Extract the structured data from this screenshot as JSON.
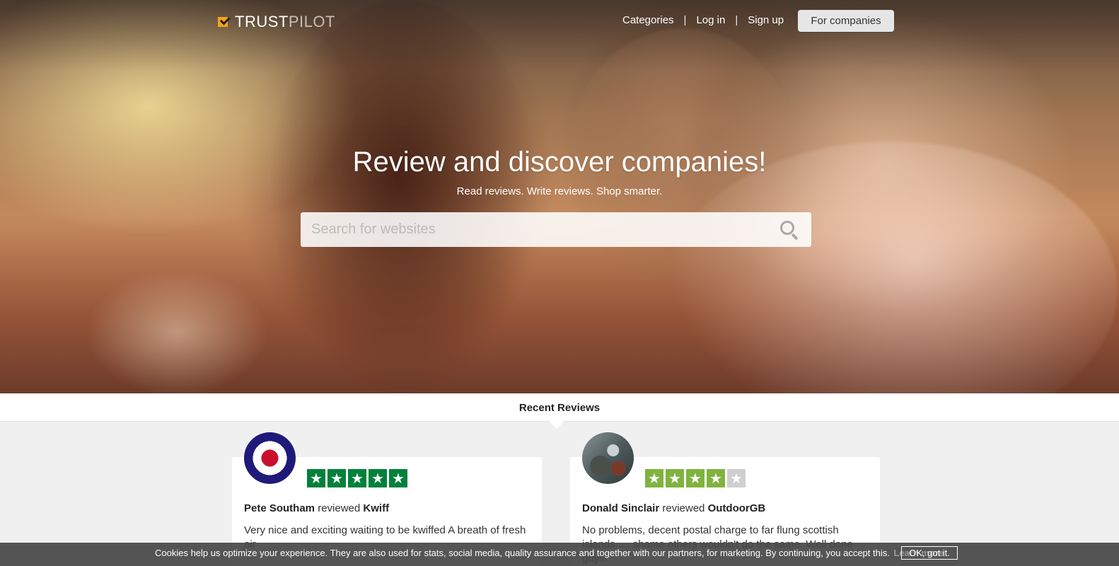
{
  "header": {
    "logo": {
      "trust": "TRUST",
      "pilot": "PILOT"
    },
    "nav": [
      {
        "label": "Categories"
      },
      {
        "label": "Log in"
      },
      {
        "label": "Sign up"
      }
    ],
    "separator": "|",
    "for_companies_label": "For companies"
  },
  "hero": {
    "title": "Review and discover companies!",
    "subtitle": "Read reviews. Write reviews. Shop smarter.",
    "search_placeholder": "Search for websites"
  },
  "recent": {
    "title": "Recent Reviews",
    "reviews": [
      {
        "reviewer": "Pete Southam",
        "verb": "reviewed",
        "company": "Kwiff",
        "rating": 5,
        "text": "Very nice and exciting waiting to be kwiffed A breath of fresh air"
      },
      {
        "reviewer": "Donald Sinclair",
        "verb": "reviewed",
        "company": "OutdoorGB",
        "rating": 4,
        "text": "No problems, decent postal charge to far flung scottish islands..... shame others wouldn't do the same. Well done guys!"
      }
    ]
  },
  "cookie": {
    "text": "Cookies help us optimize your experience. They are also used for stats, social media, quality assurance and together with our partners, for marketing. By continuing, you accept this.",
    "learn_more": "Learn more",
    "ok_label": "OK, got it."
  },
  "colors": {
    "star_five": "#00813b",
    "star_four": "#7fb33f",
    "star_empty": "#cfcfcf",
    "logo_accent": "#f2a31a"
  }
}
